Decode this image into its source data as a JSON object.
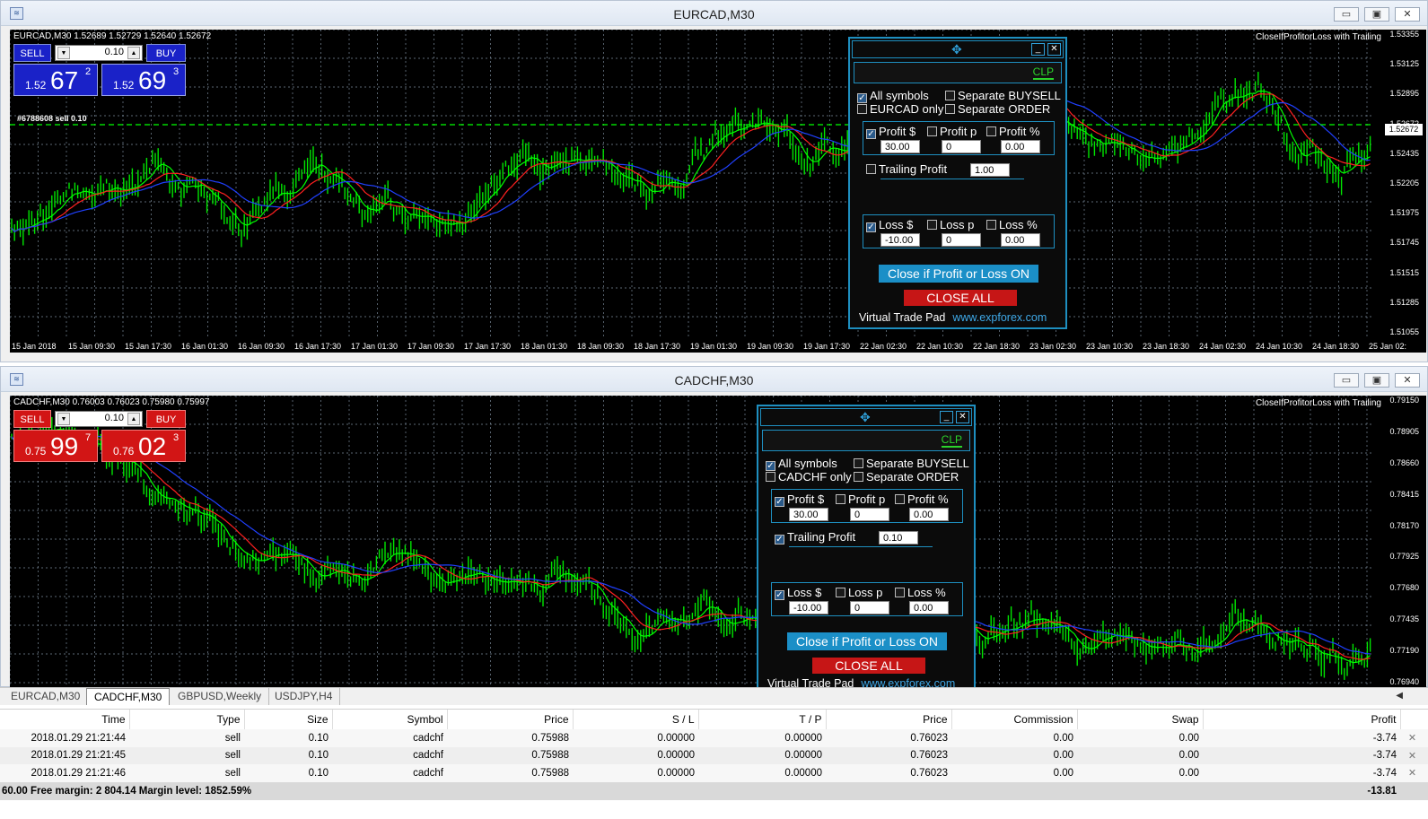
{
  "charts": [
    {
      "title": "EURCAD,M30",
      "info": "EURCAD,M30  1.52689 1.52729 1.52640 1.52672",
      "indicator_label": "CloseIfProfitorLoss with Trailing",
      "order_label": "#6788608 sell 0.10",
      "current_price": "1.52672",
      "y_ticks": [
        "1.53355",
        "1.53125",
        "1.52895",
        "1.52672",
        "1.52435",
        "1.52205",
        "1.51975",
        "1.51745",
        "1.51515",
        "1.51285",
        "1.51055"
      ],
      "x_ticks": [
        "15 Jan 2018",
        "15 Jan 09:30",
        "15 Jan 17:30",
        "16 Jan 01:30",
        "16 Jan 09:30",
        "16 Jan 17:30",
        "17 Jan 01:30",
        "17 Jan 09:30",
        "17 Jan 17:30",
        "18 Jan 01:30",
        "18 Jan 09:30",
        "18 Jan 17:30",
        "19 Jan 01:30",
        "19 Jan 09:30",
        "19 Jan 17:30",
        "22 Jan 02:30",
        "22 Jan 10:30",
        "22 Jan 18:30",
        "23 Jan 02:30",
        "23 Jan 10:30",
        "23 Jan 18:30",
        "24 Jan 02:30",
        "24 Jan 10:30",
        "24 Jan 18:30",
        "25 Jan 02:"
      ],
      "trade": {
        "sell_label": "SELL",
        "buy_label": "BUY",
        "lot": "0.10",
        "sell_small": "1.52",
        "sell_big": "67",
        "sell_sup": "2",
        "buy_small": "1.52",
        "buy_big": "69",
        "buy_sup": "3"
      },
      "panel": {
        "tab": "CLP",
        "all_symbols": "All symbols",
        "sep_buysell": "Separate BUYSELL",
        "only_symbol": "EURCAD only",
        "sep_order": "Separate ORDER",
        "profit_usd": "Profit $",
        "profit_p": "Profit p",
        "profit_pct": "Profit %",
        "profit_usd_val": "30.00",
        "profit_p_val": "0",
        "profit_pct_val": "0.00",
        "trailing": "Trailing Profit",
        "trailing_val": "1.00",
        "loss_usd": "Loss $",
        "loss_p": "Loss p",
        "loss_pct": "Loss %",
        "loss_usd_val": "-10.00",
        "loss_p_val": "0",
        "loss_pct_val": "0.00",
        "close_btn": "Close if Profit or Loss ON",
        "close_all": "CLOSE ALL",
        "footer": "Virtual Trade Pad",
        "link": "www.expforex.com"
      }
    },
    {
      "title": "CADCHF,M30",
      "info": "CADCHF,M30  0.76003 0.76023 0.75980 0.75997",
      "indicator_label": "CloseIfProfitorLoss with Trailing",
      "y_ticks": [
        "0.79150",
        "0.78905",
        "0.78660",
        "0.78415",
        "0.78170",
        "0.77925",
        "0.77680",
        "0.77435",
        "0.77190",
        "0.76940"
      ],
      "trade": {
        "sell_label": "SELL",
        "buy_label": "BUY",
        "lot": "0.10",
        "sell_small": "0.75",
        "sell_big": "99",
        "sell_sup": "7",
        "buy_small": "0.76",
        "buy_big": "02",
        "buy_sup": "3"
      },
      "panel": {
        "tab": "CLP",
        "all_symbols": "All symbols",
        "sep_buysell": "Separate BUYSELL",
        "only_symbol": "CADCHF only",
        "sep_order": "Separate ORDER",
        "profit_usd": "Profit $",
        "profit_p": "Profit p",
        "profit_pct": "Profit %",
        "profit_usd_val": "30.00",
        "profit_p_val": "0",
        "profit_pct_val": "0.00",
        "trailing": "Trailing Profit",
        "trailing_val": "0.10",
        "loss_usd": "Loss $",
        "loss_p": "Loss p",
        "loss_pct": "Loss %",
        "loss_usd_val": "-10.00",
        "loss_p_val": "0",
        "loss_pct_val": "0.00",
        "close_btn": "Close if Profit or Loss ON",
        "close_all": "CLOSE ALL",
        "footer": "Virtual Trade Pad",
        "link": "www.expforex.com"
      }
    }
  ],
  "tabs": [
    "EURCAD,M30",
    "CADCHF,M30",
    "GBPUSD,Weekly",
    "USDJPY,H4"
  ],
  "columns": [
    "Time",
    "Type",
    "Size",
    "Symbol",
    "Price",
    "S / L",
    "T / P",
    "Price",
    "Commission",
    "Swap",
    "Profit"
  ],
  "rows": [
    [
      "2018.01.29 21:21:44",
      "sell",
      "0.10",
      "cadchf",
      "0.75988",
      "0.00000",
      "0.00000",
      "0.76023",
      "0.00",
      "0.00",
      "-3.74"
    ],
    [
      "2018.01.29 21:21:45",
      "sell",
      "0.10",
      "cadchf",
      "0.75988",
      "0.00000",
      "0.00000",
      "0.76023",
      "0.00",
      "0.00",
      "-3.74"
    ],
    [
      "2018.01.29 21:21:46",
      "sell",
      "0.10",
      "cadchf",
      "0.75988",
      "0.00000",
      "0.00000",
      "0.76023",
      "0.00",
      "0.00",
      "-3.74"
    ]
  ],
  "summary": {
    "text": "60.00  Free margin: 2 804.14  Margin level: 1852.59%",
    "total": "-13.81"
  },
  "colors": {
    "candle": "#00e600",
    "ma_fast": "#00ff00",
    "ma_mid": "#ff2020",
    "ma_slow": "#2040ff",
    "grid": "#7a8a9a"
  }
}
